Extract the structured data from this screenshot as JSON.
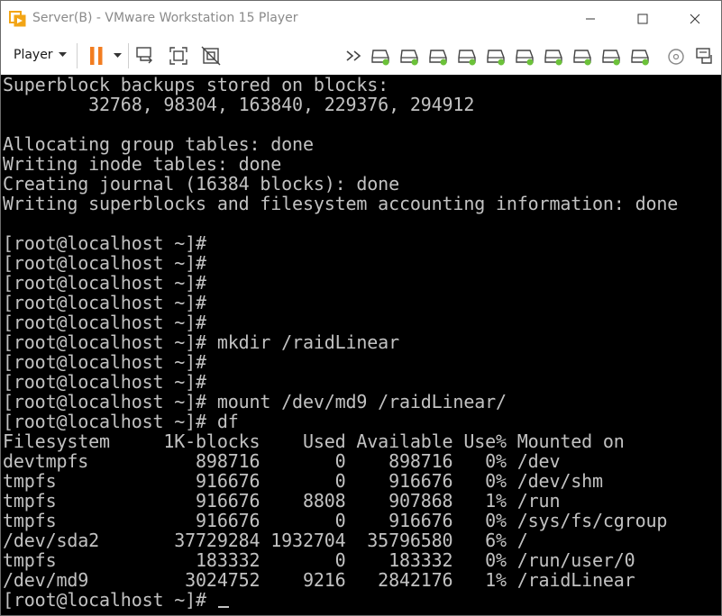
{
  "window": {
    "title": "Server(B) - VMware Workstation 15 Player",
    "app_icon": "vmware-player-icon"
  },
  "toolbar": {
    "player_label": "Player",
    "icons": [
      "pause-icon",
      "dropdown-icon",
      "send-ctrl-alt-del-icon",
      "fit-guest-icon",
      "unity-icon",
      "more-icon",
      "hard-disk-icon",
      "cd-dvd-icon",
      "network-icon",
      "usb-icon",
      "sound-icon",
      "message-icon"
    ]
  },
  "terminal": {
    "lines": [
      "Superblock backups stored on blocks:",
      "        32768, 98304, 163840, 229376, 294912",
      "",
      "Allocating group tables: done",
      "Writing inode tables: done",
      "Creating journal (16384 blocks): done",
      "Writing superblocks and filesystem accounting information: done",
      "",
      "[root@localhost ~]#",
      "[root@localhost ~]#",
      "[root@localhost ~]#",
      "[root@localhost ~]#",
      "[root@localhost ~]#",
      "[root@localhost ~]# mkdir /raidLinear",
      "[root@localhost ~]#",
      "[root@localhost ~]#",
      "[root@localhost ~]# mount /dev/md9 /raidLinear/",
      "[root@localhost ~]# df",
      "Filesystem     1K-blocks    Used Available Use% Mounted on",
      "devtmpfs          898716       0    898716   0% /dev",
      "tmpfs             916676       0    916676   0% /dev/shm",
      "tmpfs             916676    8808    907868   1% /run",
      "tmpfs             916676       0    916676   0% /sys/fs/cgroup",
      "/dev/sda2       37729284 1932704  35796580   6% /",
      "tmpfs             183332       0    183332   0% /run/user/0",
      "/dev/md9         3024752    9216   2842176   1% /raidLinear",
      "[root@localhost ~]# "
    ]
  },
  "colors": {
    "terminal_bg": "#000000",
    "terminal_fg": "#c2c2c2",
    "pause_orange": "#f27d21",
    "device_green": "#6cc23a"
  }
}
